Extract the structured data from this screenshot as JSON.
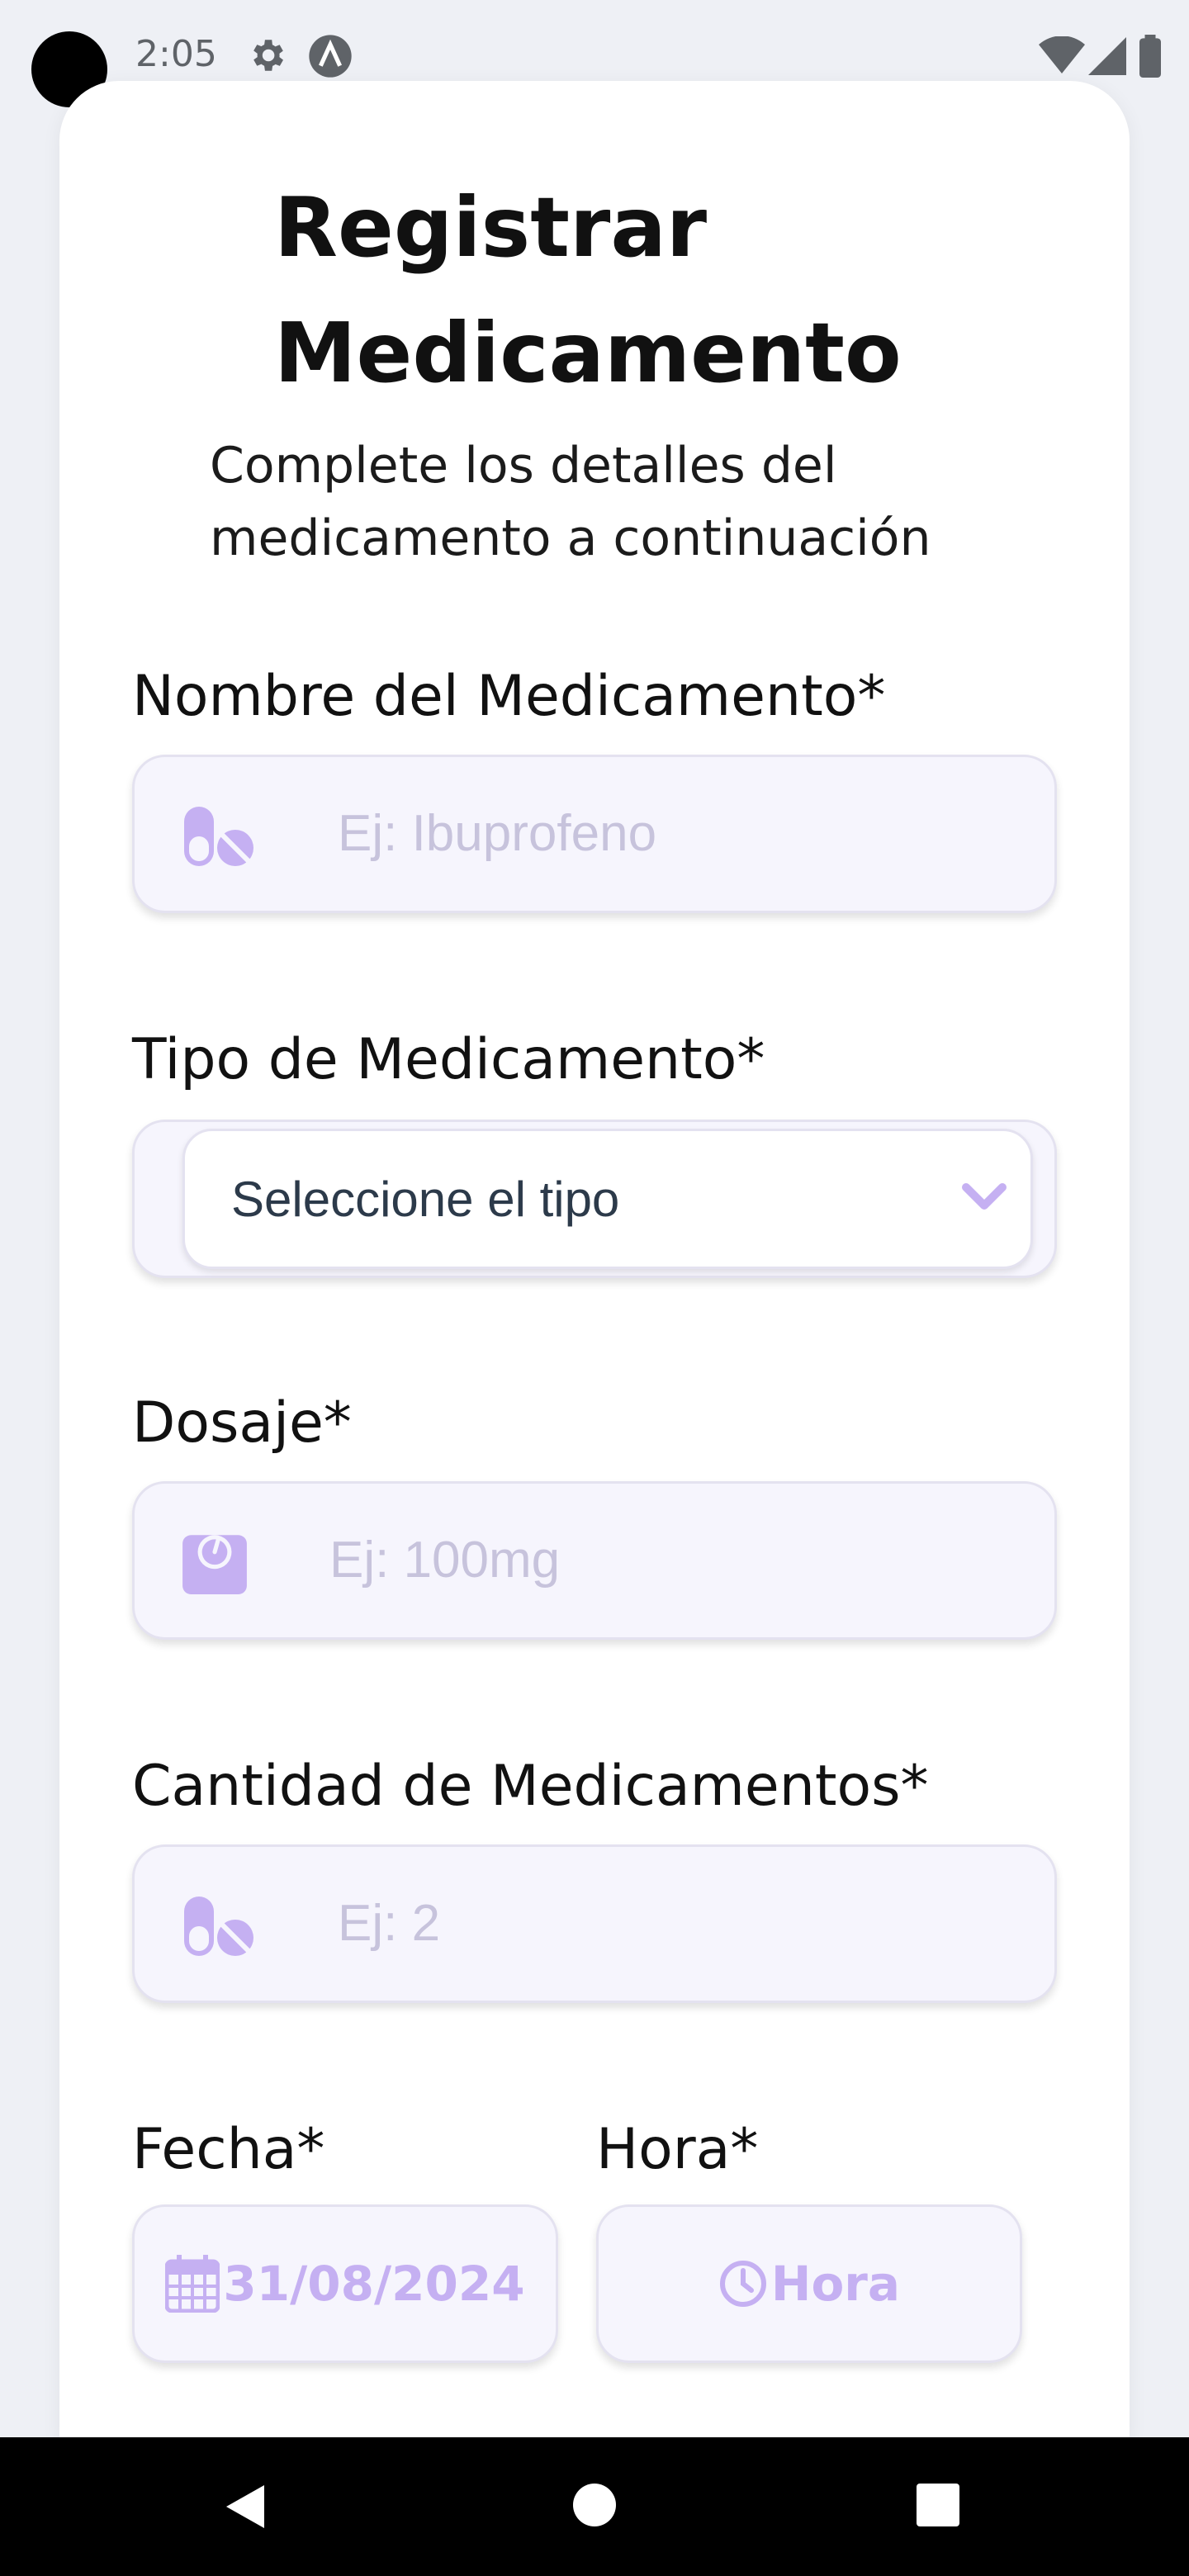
{
  "status_bar": {
    "time": "2:05",
    "icons": [
      "settings-icon",
      "app-notification-icon",
      "wifi-icon",
      "signal-icon",
      "battery-icon"
    ]
  },
  "page": {
    "title_line1": "Registrar",
    "title_line2": "Medicamento",
    "subtitle_line1": "Complete los detalles del",
    "subtitle_line2": "medicamento a continuación"
  },
  "form": {
    "name": {
      "label": "Nombre del Medicamento*",
      "placeholder": "Ej: Ibuprofeno",
      "icon": "pills-icon"
    },
    "type": {
      "label": "Tipo de Medicamento*",
      "selected": "Seleccione el tipo",
      "icon": "chevron-down-icon"
    },
    "dosage": {
      "label": "Dosaje*",
      "placeholder": "Ej: 100mg",
      "icon": "scale-icon"
    },
    "quantity": {
      "label": "Cantidad de Medicamentos*",
      "placeholder": "Ej: 2",
      "icon": "pills-icon"
    },
    "date": {
      "label": "Fecha*",
      "value": "31/08/2024",
      "icon": "calendar-icon"
    },
    "time": {
      "label": "Hora*",
      "value": "Hora",
      "icon": "clock-icon"
    }
  },
  "colors": {
    "accent": "#c5b0f2",
    "field_bg": "#f6f5fd",
    "placeholder": "#c7c3dc"
  },
  "nav": [
    "back-icon",
    "home-icon",
    "recents-icon"
  ]
}
